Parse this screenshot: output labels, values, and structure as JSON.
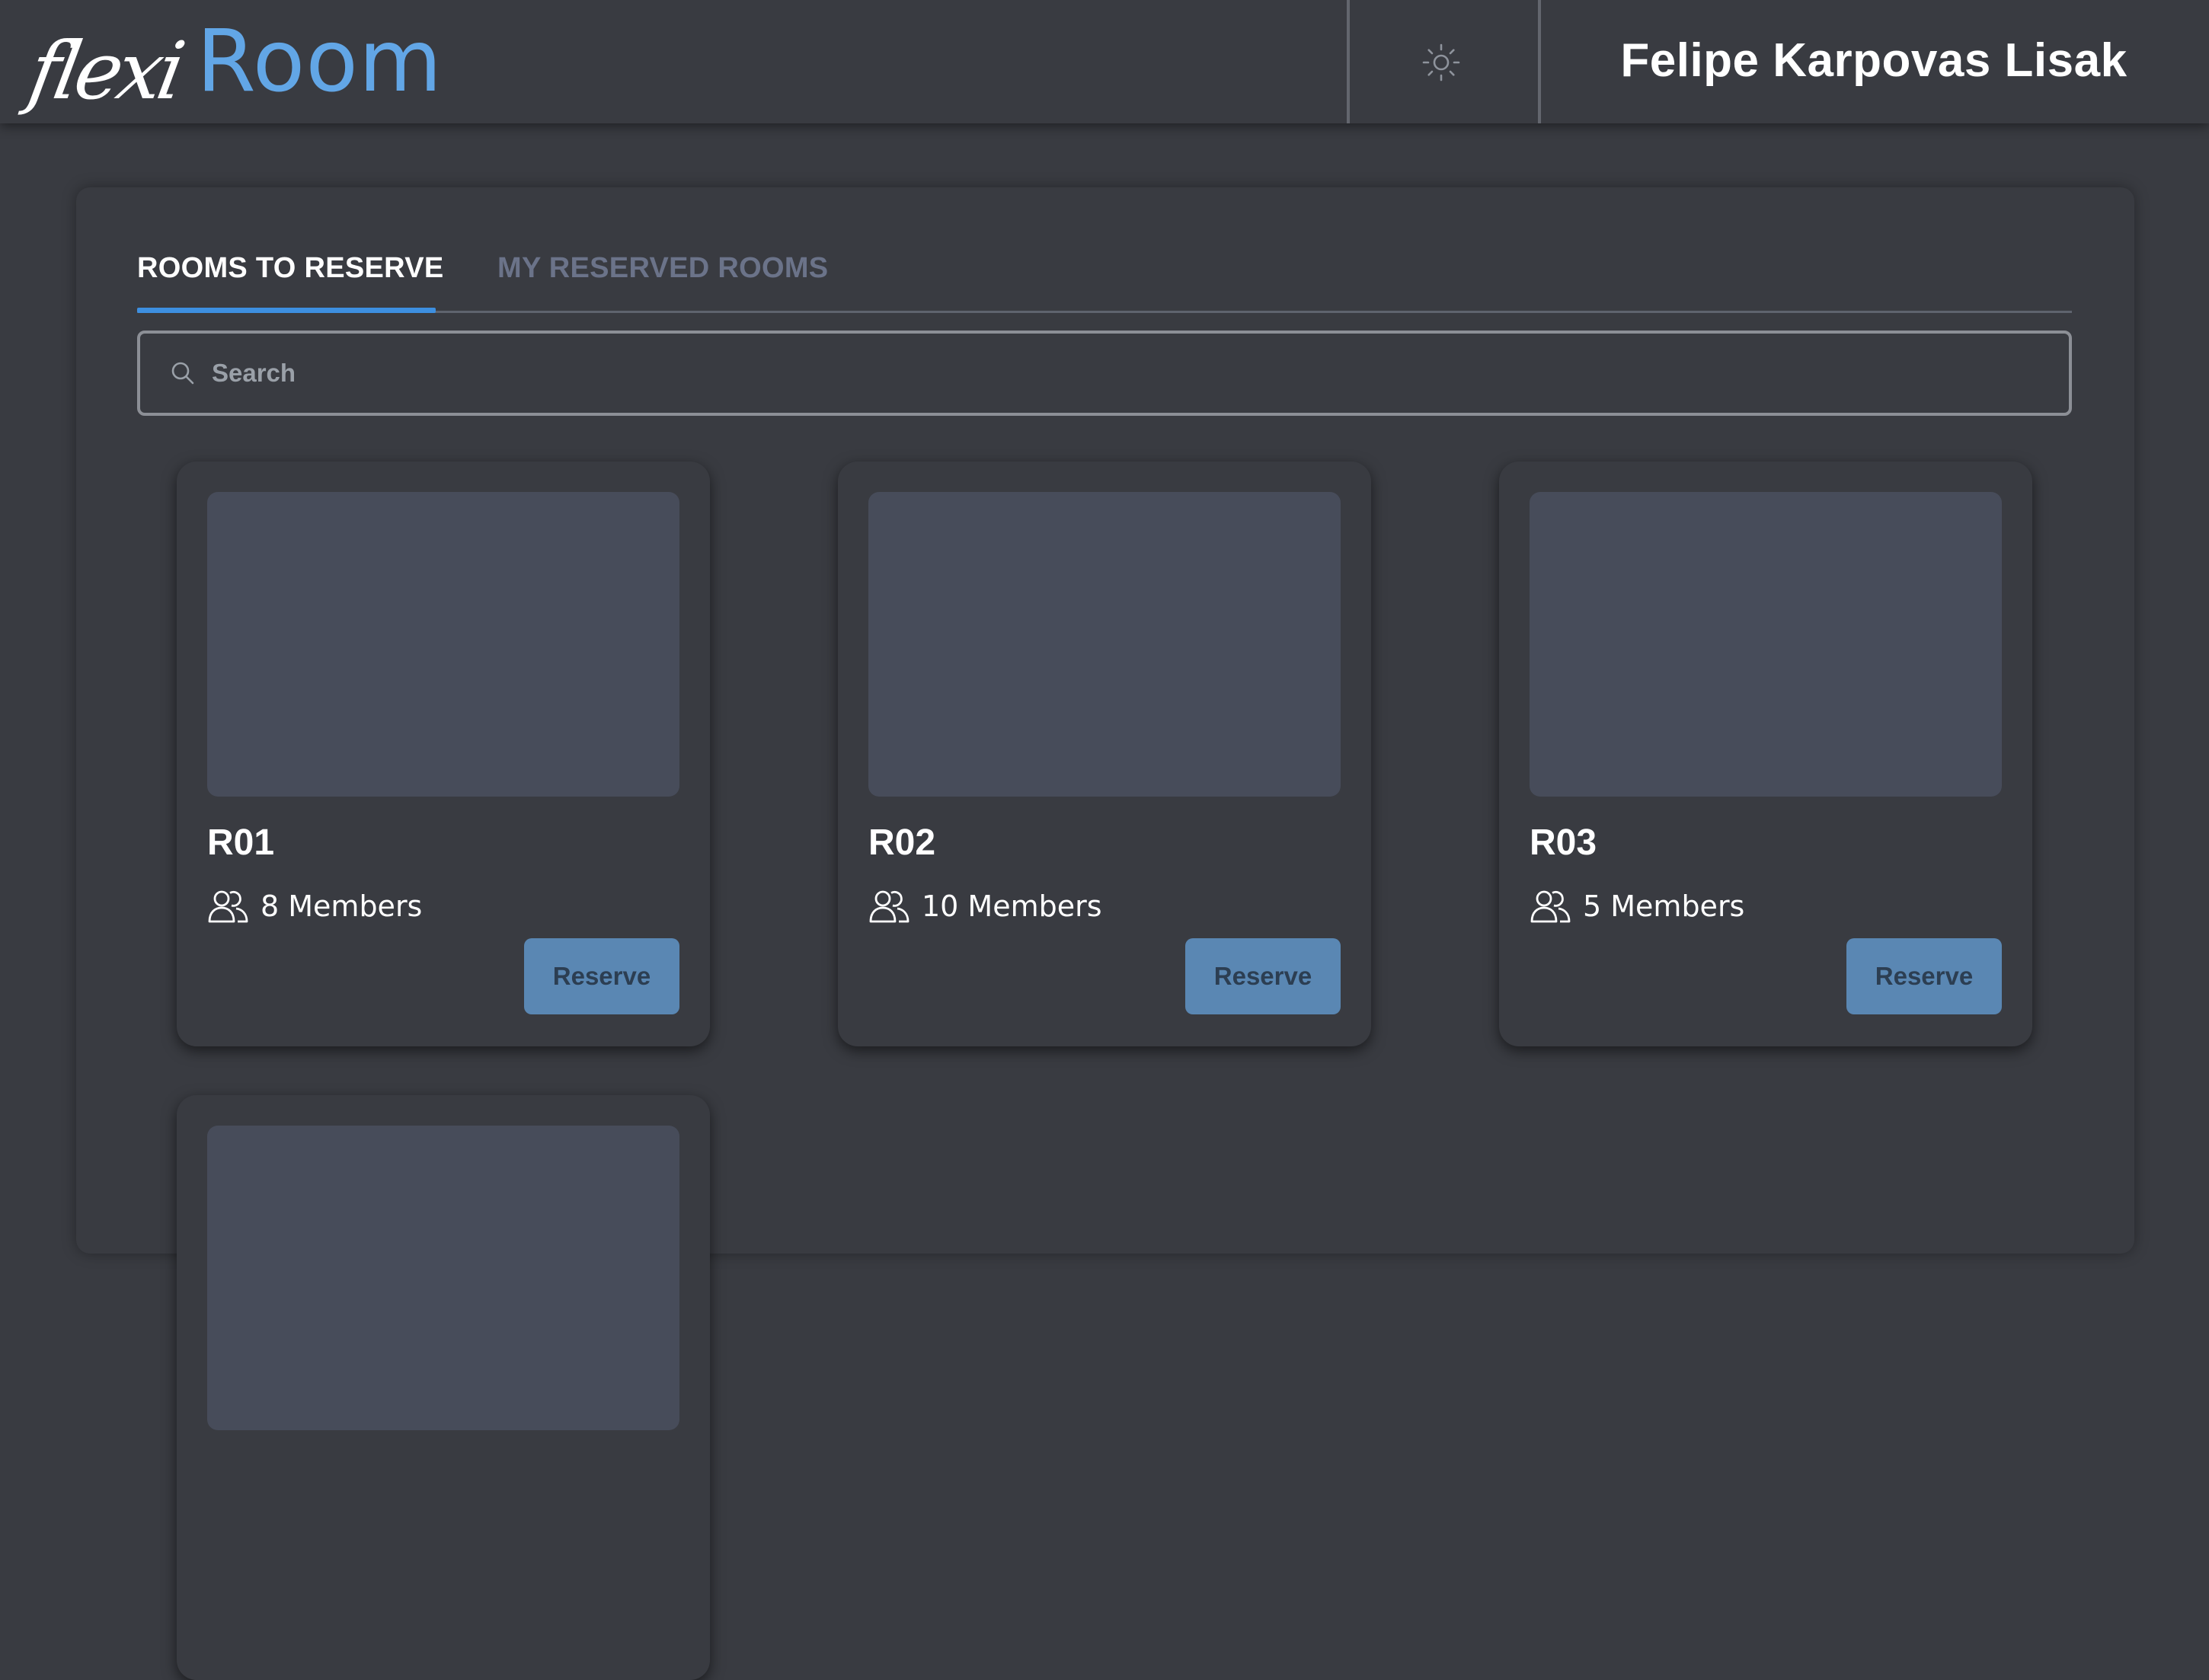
{
  "header": {
    "logo_script": "flexi",
    "logo_word": "Room",
    "user_name": "Felipe Karpovas Lisak",
    "theme_icon": "sun-icon"
  },
  "tabs": [
    {
      "label": "ROOMS TO RESERVE",
      "active": true
    },
    {
      "label": "MY RESERVED ROOMS",
      "active": false
    }
  ],
  "search": {
    "placeholder": "Search",
    "value": ""
  },
  "rooms": [
    {
      "name": "R01",
      "members": "8 Members",
      "action": "Reserve"
    },
    {
      "name": "R02",
      "members": "10 Members",
      "action": "Reserve"
    },
    {
      "name": "R03",
      "members": "5 Members",
      "action": "Reserve"
    }
  ],
  "colors": {
    "background": "#393b41",
    "accent": "#62a6e6",
    "tab_indicator": "#3d8fe0",
    "button": "#5a87b3",
    "image_placeholder": "#474c5a"
  }
}
